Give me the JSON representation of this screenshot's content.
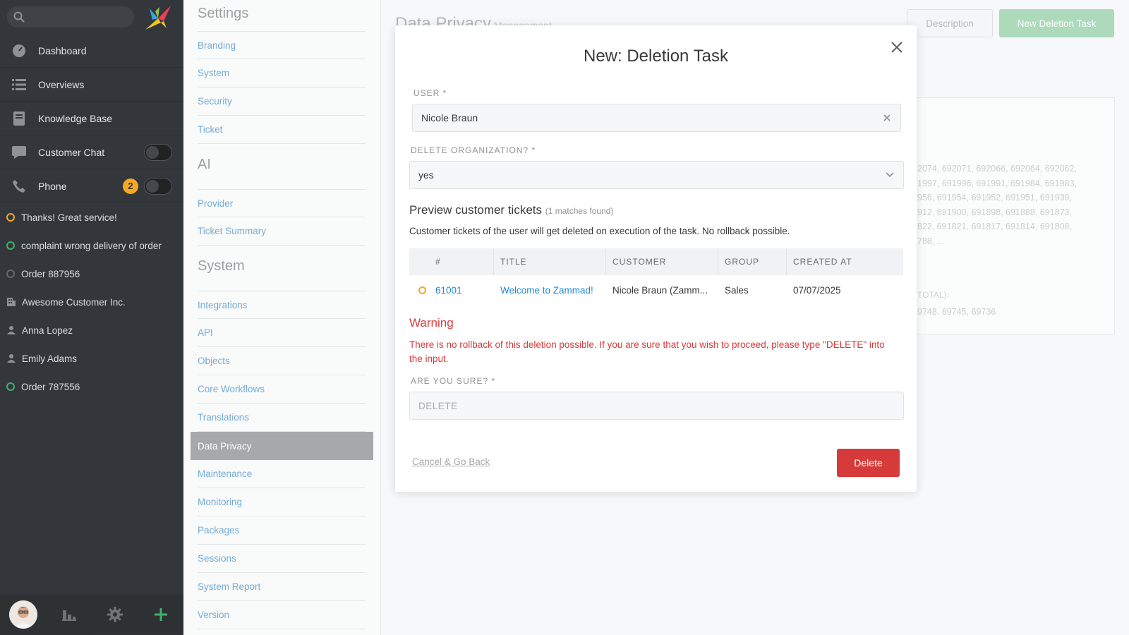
{
  "nav": {
    "search_placeholder": "",
    "main_items": [
      {
        "label": "Dashboard",
        "icon": "dashboard-icon"
      },
      {
        "label": "Overviews",
        "icon": "list-icon"
      },
      {
        "label": "Knowledge Base",
        "icon": "book-icon"
      },
      {
        "label": "Customer Chat",
        "icon": "chat-icon"
      },
      {
        "label": "Phone",
        "icon": "phone-icon",
        "badge": "2"
      }
    ],
    "tasks": [
      {
        "label": "Thanks! Great service!",
        "status": "pending",
        "color": "#f6a51c"
      },
      {
        "label": "complaint wrong delivery of order",
        "status": "open",
        "color": "#38ad69"
      },
      {
        "label": "Order 887956",
        "status": "closed",
        "color": "#5d6165"
      },
      {
        "label": "Awesome Customer Inc.",
        "icon": "organization-icon"
      },
      {
        "label": "Anna Lopez",
        "icon": "user-icon"
      },
      {
        "label": "Emily Adams",
        "icon": "user-icon"
      },
      {
        "label": "Order 787556",
        "status": "open",
        "color": "#38ad69"
      }
    ]
  },
  "settings": {
    "sections": [
      {
        "title": "Settings",
        "items": [
          "Branding",
          "System",
          "Security",
          "Ticket"
        ]
      },
      {
        "title": "AI",
        "items": [
          "Provider",
          "Ticket Summary"
        ]
      },
      {
        "title": "System",
        "items": [
          "Integrations",
          "API",
          "Objects",
          "Core Workflows",
          "Translations",
          "Data Privacy",
          "Maintenance",
          "Monitoring",
          "Packages",
          "Sessions",
          "System Report",
          "Version"
        ]
      }
    ],
    "active": "Data Privacy"
  },
  "main": {
    "title": "Data Privacy",
    "subtitle": "Management",
    "description_button": "Description",
    "new_task_button": "New Deletion Task",
    "bg_ids_text": "2074, 692071, 692066, 692064, 692062, 1997, 691996, 691991, 691984, 691983, 956, 691954, 691952, 691951, 691939, 912, 691900, 691898, 691888, 691873, 822, 691821, 691817, 691814, 691808, 788, ...",
    "bg_total_label": "TOTAL):",
    "bg_ids2_text": "9748, 69745, 69736"
  },
  "modal": {
    "title": "New: Deletion Task",
    "user_label": "USER *",
    "user_value": "Nicole Braun",
    "delete_org_label": "DELETE ORGANIZATION? *",
    "delete_org_value": "yes",
    "preview_title": "Preview customer tickets",
    "preview_count": "(1 matches found)",
    "preview_text": "Customer tickets of the user will get deleted on execution of the task. No rollback possible.",
    "table": {
      "headers": [
        "#",
        "TITLE",
        "CUSTOMER",
        "GROUP",
        "CREATED AT"
      ],
      "rows": [
        {
          "number": "61001",
          "title": "Welcome to Zammad!",
          "customer": "Nicole Braun (Zamm...",
          "group": "Sales",
          "created_at": "07/07/2025",
          "status": "pending"
        }
      ]
    },
    "warning_title": "Warning",
    "warning_text": "There is no rollback of this deletion possible. If you are sure that you wish to proceed, please type \"DELETE\" into the input.",
    "confirm_label": "ARE YOU SURE? *",
    "confirm_placeholder": "DELETE",
    "cancel_label": "Cancel & Go Back",
    "delete_label": "Delete"
  },
  "colors": {
    "nav_bg": "#2b2f33",
    "link": "#1e8bd4",
    "danger": "#d63a3a",
    "success_light": "#a9d9b8",
    "pending": "#f6a51c",
    "open": "#38ad69"
  }
}
